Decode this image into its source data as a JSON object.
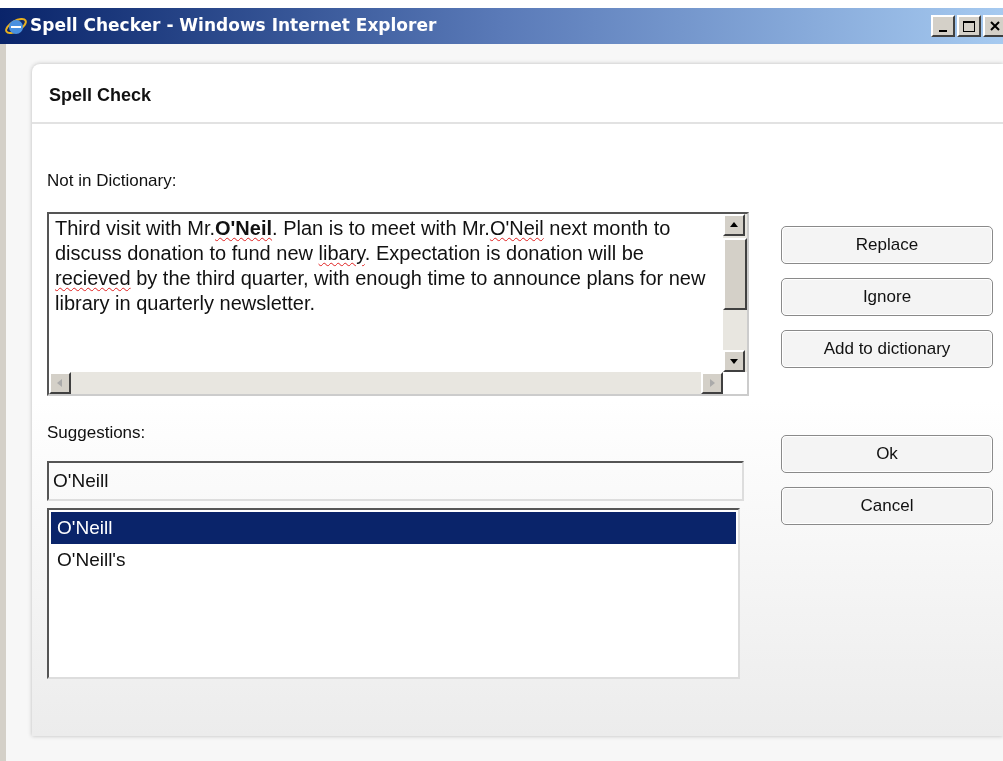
{
  "window": {
    "title": "Spell Checker - Windows Internet Explorer"
  },
  "dialog": {
    "heading": "Spell Check",
    "not_in_dictionary": {
      "label": "Not in Dictionary:",
      "segments": [
        {
          "text": "Third visit with Mr.",
          "misspelled": false,
          "current": false
        },
        {
          "text": "O'Neil",
          "misspelled": true,
          "current": true
        },
        {
          "text": ". Plan is to meet with Mr.",
          "misspelled": false,
          "current": false
        },
        {
          "text": "O'Neil",
          "misspelled": true,
          "current": false
        },
        {
          "text": " next month to discuss donation to fund new ",
          "misspelled": false,
          "current": false
        },
        {
          "text": "libary",
          "misspelled": true,
          "current": false
        },
        {
          "text": ". Expectation is donation will be ",
          "misspelled": false,
          "current": false
        },
        {
          "text": "recieved",
          "misspelled": true,
          "current": false
        },
        {
          "text": " by the third quarter, with enough time to announce plans for new library in quarterly newsletter.",
          "misspelled": false,
          "current": false
        }
      ]
    },
    "suggestions": {
      "label": "Suggestions:",
      "value": "O'Neill",
      "items": [
        {
          "label": "O'Neill",
          "selected": true
        },
        {
          "label": "O'Neill's",
          "selected": false
        }
      ]
    },
    "actions": [
      "Replace",
      "Ignore",
      "Add to dictionary"
    ],
    "buttons": [
      "Ok",
      "Cancel"
    ]
  }
}
